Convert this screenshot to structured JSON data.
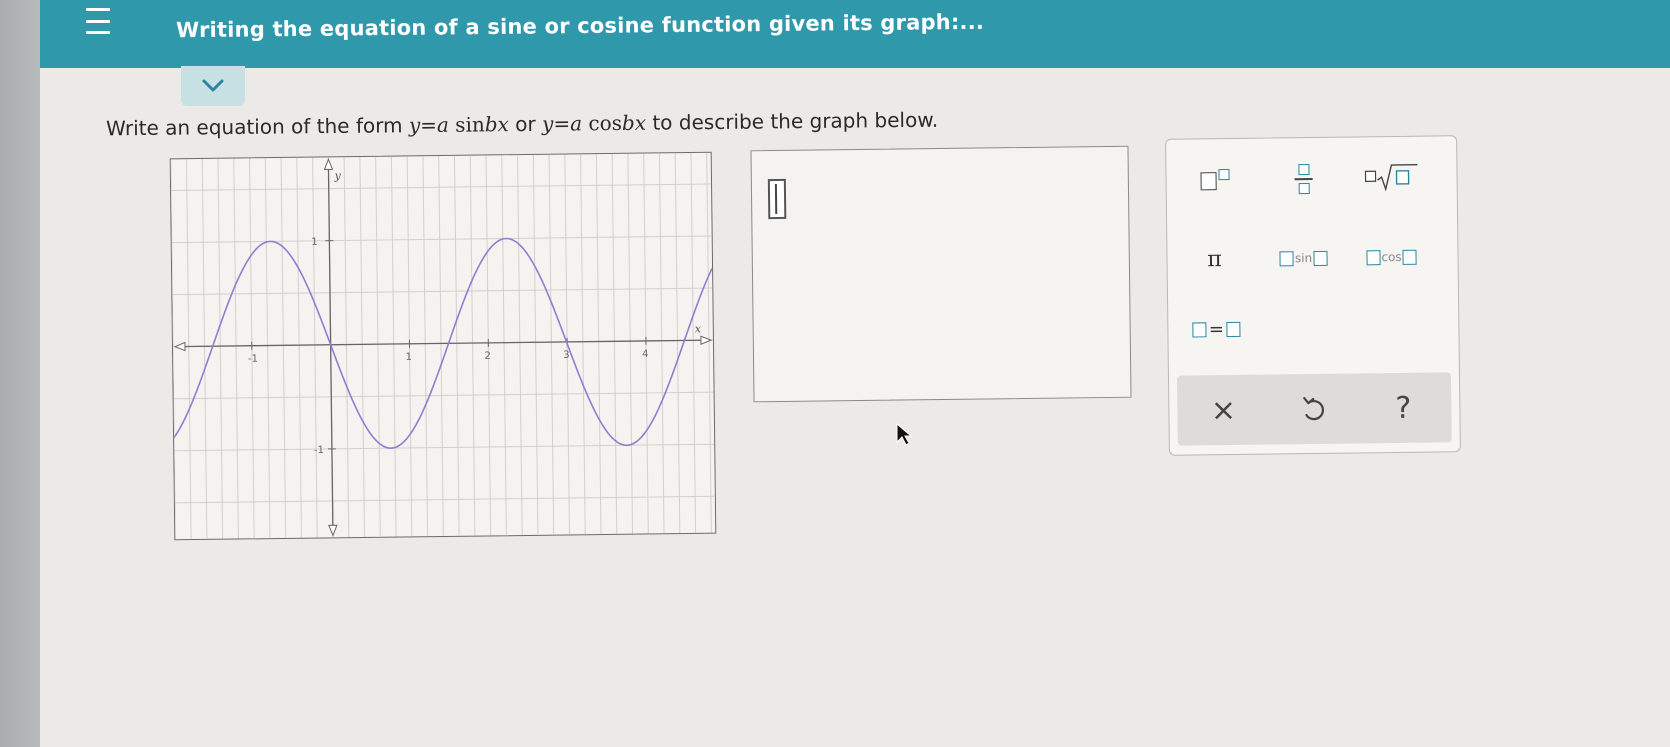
{
  "header": {
    "title": "Writing the equation of a sine or cosine function given its graph:..."
  },
  "question": {
    "prompt_start": "Write an equation of the form ",
    "form1_y": "y",
    "form1_eq": "=",
    "form1_a": "a",
    "form1_fn": "sin",
    "form1_bx": "bx",
    "connector": " or ",
    "form2_y": "y",
    "form2_eq": "=",
    "form2_a": "a",
    "form2_fn": "cos",
    "form2_bx": "bx",
    "prompt_end": " to describe the graph below."
  },
  "graph": {
    "x_axis_label": "x",
    "y_axis_label": "y",
    "x_tick_labels": [
      "-1",
      "1",
      "2",
      "3",
      "4"
    ],
    "y_tick_labels": [
      "1",
      "-1"
    ],
    "curve_color": "#8e7fd0",
    "x_range": [
      -2,
      4.85
    ],
    "y_range": [
      -1.85,
      1.8
    ],
    "function": "-sin(2.1x)"
  },
  "keypad": {
    "pi_label": "π",
    "sin_label": "sin",
    "cos_label": "cos",
    "equals_label": "=",
    "clear_label": "×",
    "undo_label": "↺",
    "help_label": "?"
  },
  "colors": {
    "header": "#2f98ab",
    "accent": "#2a85a0"
  }
}
